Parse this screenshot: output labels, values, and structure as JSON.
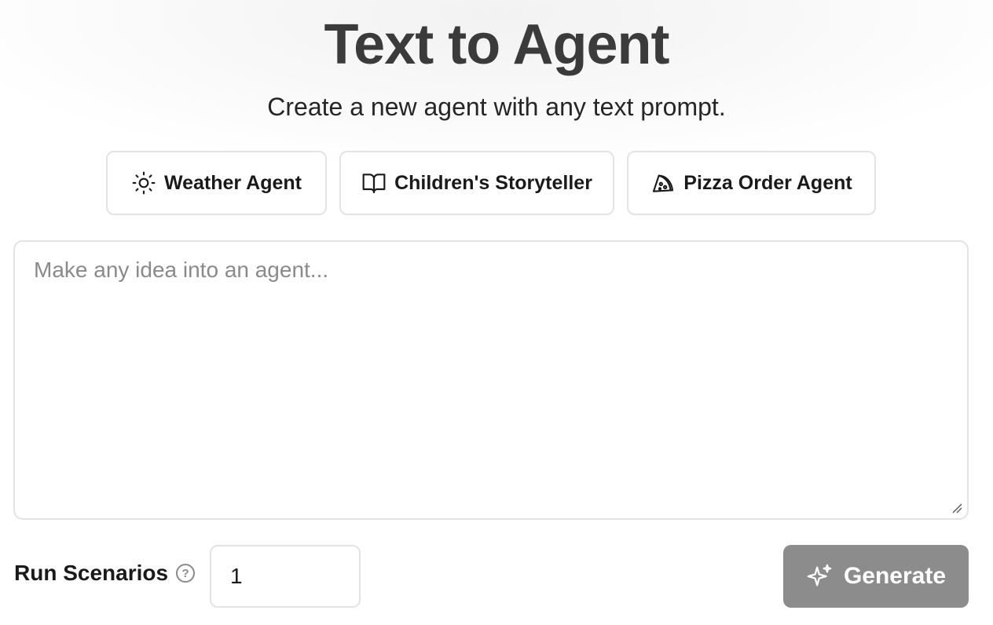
{
  "header": {
    "title": "Text to Agent",
    "subtitle": "Create a new agent with any text prompt."
  },
  "templates": [
    {
      "label": "Weather Agent",
      "icon": "sun-icon"
    },
    {
      "label": "Children's Storyteller",
      "icon": "book-open-icon"
    },
    {
      "label": "Pizza Order Agent",
      "icon": "pizza-icon"
    }
  ],
  "prompt": {
    "value": "",
    "placeholder": "Make any idea into an agent..."
  },
  "footer": {
    "run_scenarios_label": "Run Scenarios",
    "help_icon": "question-circle-icon",
    "run_scenarios_value": "1",
    "generate_label": "Generate",
    "generate_icon": "sparkles-icon"
  },
  "colors": {
    "title": "#3b3b3b",
    "generate_bg": "#8c8c8c",
    "border": "#e3e3e3",
    "placeholder": "#8a8a8a"
  }
}
